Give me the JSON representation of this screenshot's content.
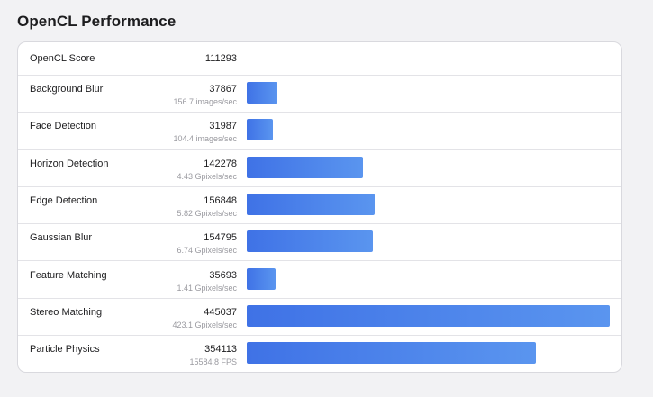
{
  "title": "OpenCL Performance",
  "colors": {
    "bar_start": "#3f72e6",
    "bar_end": "#5a95ef"
  },
  "overall": {
    "label": "OpenCL Score",
    "score": "111293"
  },
  "bar_scale_max": 445037,
  "workloads": [
    {
      "name": "Background Blur",
      "score": "37867",
      "rate": "156.7 images/sec",
      "value": 37867
    },
    {
      "name": "Face Detection",
      "score": "31987",
      "rate": "104.4 images/sec",
      "value": 31987
    },
    {
      "name": "Horizon Detection",
      "score": "142278",
      "rate": "4.43 Gpixels/sec",
      "value": 142278
    },
    {
      "name": "Edge Detection",
      "score": "156848",
      "rate": "5.82 Gpixels/sec",
      "value": 156848
    },
    {
      "name": "Gaussian Blur",
      "score": "154795",
      "rate": "6.74 Gpixels/sec",
      "value": 154795
    },
    {
      "name": "Feature Matching",
      "score": "35693",
      "rate": "1.41 Gpixels/sec",
      "value": 35693
    },
    {
      "name": "Stereo Matching",
      "score": "445037",
      "rate": "423.1 Gpixels/sec",
      "value": 445037
    },
    {
      "name": "Particle Physics",
      "score": "354113",
      "rate": "15584.8 FPS",
      "value": 354113
    }
  ]
}
